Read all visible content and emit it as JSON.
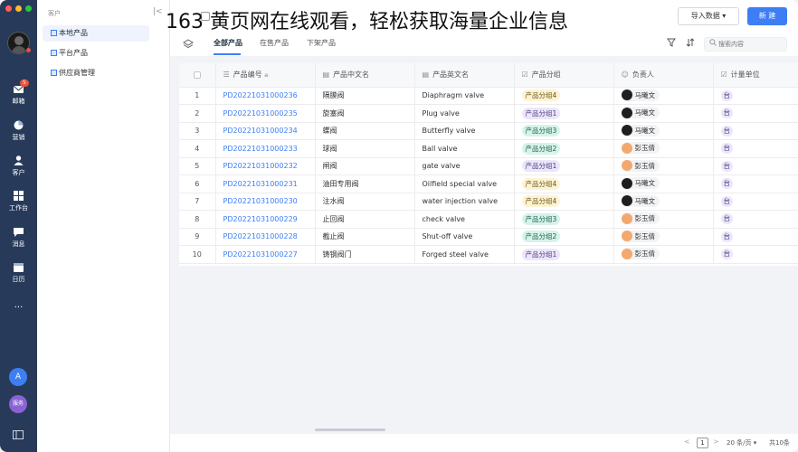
{
  "overlay_title": "163 黄页网在线观看，轻松获取海量企业信息",
  "colors": {
    "accent": "#3d7ef5",
    "rail": "#283a5a",
    "badge": "#e4533f"
  },
  "rail": {
    "items": [
      {
        "label": "邮箱",
        "icon": "mail-icon",
        "badge": "5"
      },
      {
        "label": "营销",
        "icon": "pie-chart-icon"
      },
      {
        "label": "客户",
        "icon": "customer-icon"
      },
      {
        "label": "工作台",
        "icon": "workbench-icon"
      },
      {
        "label": "消息",
        "icon": "message-icon"
      },
      {
        "label": "日历",
        "icon": "calendar-icon"
      },
      {
        "label": "···",
        "icon": "more-icon"
      }
    ],
    "bottom_a": "A",
    "bottom_b": "服务"
  },
  "sidebar": {
    "heading": "客户",
    "collapse": "|<",
    "items": [
      {
        "label": "本地产品"
      },
      {
        "label": "平台产品"
      },
      {
        "label": "供应商管理"
      }
    ]
  },
  "toolbar": {
    "import_label": "导入数据 ▾",
    "new_label": "新 建"
  },
  "tabs": [
    {
      "label": "全部产品"
    },
    {
      "label": "在售产品"
    },
    {
      "label": "下架产品"
    }
  ],
  "search": {
    "placeholder": "搜索内容"
  },
  "table": {
    "headers": [
      "产品编号",
      "产品中文名",
      "产品英文名",
      "产品分组",
      "负责人",
      "计量单位"
    ],
    "rows": [
      {
        "n": "1",
        "code": "PD20221031000236",
        "cn": "隔膜阀",
        "en": "Diaphragm valve",
        "group": "产品分组4",
        "owner": "马曦文",
        "unit": "台"
      },
      {
        "n": "2",
        "code": "PD20221031000235",
        "cn": "旋塞阀",
        "en": "Plug valve",
        "group": "产品分组1",
        "owner": "马曦文",
        "unit": "台"
      },
      {
        "n": "3",
        "code": "PD20221031000234",
        "cn": "蝶阀",
        "en": "Butterfly valve",
        "group": "产品分组3",
        "owner": "马曦文",
        "unit": "台"
      },
      {
        "n": "4",
        "code": "PD20221031000233",
        "cn": "球阀",
        "en": "Ball valve",
        "group": "产品分组2",
        "owner": "彭玉倩",
        "unit": "台"
      },
      {
        "n": "5",
        "code": "PD20221031000232",
        "cn": "闸阀",
        "en": "gate valve",
        "group": "产品分组1",
        "owner": "彭玉倩",
        "unit": "台"
      },
      {
        "n": "6",
        "code": "PD20221031000231",
        "cn": "油田专用阀",
        "en": "Oilfield special valve",
        "group": "产品分组4",
        "owner": "马曦文",
        "unit": "台"
      },
      {
        "n": "7",
        "code": "PD20221031000230",
        "cn": "注水阀",
        "en": "water injection valve",
        "group": "产品分组4",
        "owner": "马曦文",
        "unit": "台"
      },
      {
        "n": "8",
        "code": "PD20221031000229",
        "cn": "止回阀",
        "en": "check valve",
        "group": "产品分组3",
        "owner": "彭玉倩",
        "unit": "台"
      },
      {
        "n": "9",
        "code": "PD20221031000228",
        "cn": "截止阀",
        "en": "Shut-off valve",
        "group": "产品分组2",
        "owner": "彭玉倩",
        "unit": "台"
      },
      {
        "n": "10",
        "code": "PD20221031000227",
        "cn": "铸钢阀门",
        "en": "Forged steel valve",
        "group": "产品分组1",
        "owner": "彭玉倩",
        "unit": "台"
      }
    ]
  },
  "pager": {
    "prev": "<",
    "page": "1",
    "next": ">",
    "size": "20 条/页 ▾",
    "total": "共10条"
  }
}
